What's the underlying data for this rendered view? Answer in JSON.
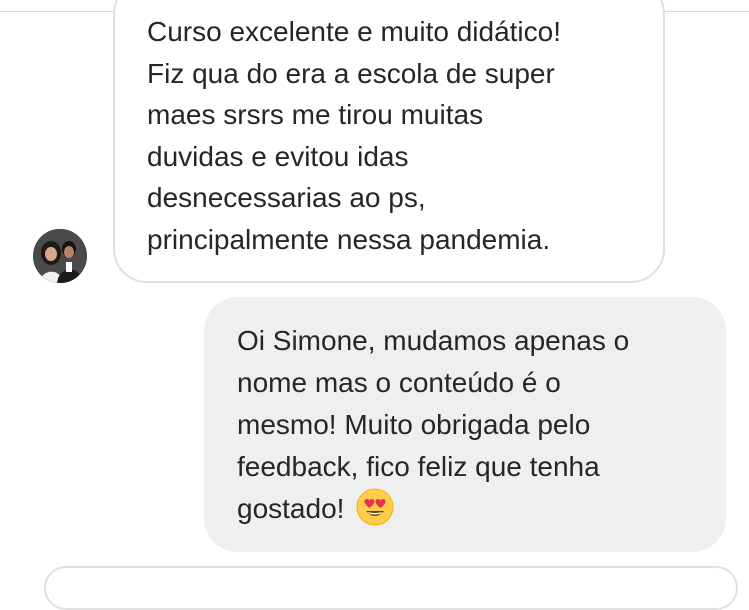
{
  "thread": {
    "incoming_message": {
      "text": "Curso excelente e muito didático!\nFiz qua do era a escola  de super\nmaes srsrs me tirou muitas\nduvidas e evitou idas\ndesnecessarias ao ps,\nprincipalmente nessa pandemia.",
      "avatar_icon": "user-photo-icon"
    },
    "outgoing_message": {
      "text": "Oi Simone, mudamos apenas o\nnome mas o conteúdo é o\nmesmo! Muito obrigada pelo\nfeedback, fico feliz que tenha\ngostado!",
      "emoji_icon": "heart-eyes-emoji-icon"
    }
  },
  "colors": {
    "incoming_bubble_border": "#e0e0e0",
    "outgoing_bubble_bg": "#efefef",
    "text": "#262626"
  }
}
